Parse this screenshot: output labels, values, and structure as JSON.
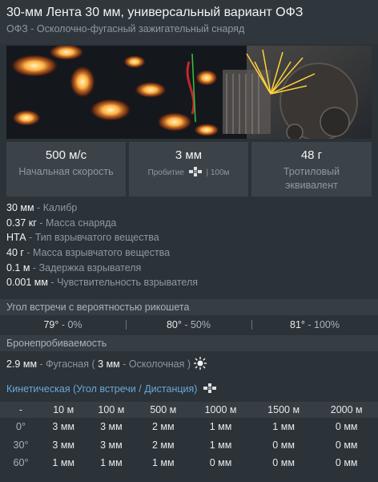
{
  "header": {
    "title": "30-мм Лента 30 мм, универсальный вариант ОФЗ",
    "subtitle": "ОФЗ - Осколочно-фугасный зажигательный снаряд"
  },
  "stats": [
    {
      "value": "500 м/с",
      "label": "Начальная скорость"
    },
    {
      "value": "3 мм",
      "label_prefix": "Пробитие",
      "label_suffix": "| 100м",
      "icon": "penetration-target-icon"
    },
    {
      "value": "48 г",
      "label": "Тротиловый эквивалент"
    }
  ],
  "properties": [
    {
      "value": "30 мм",
      "label": "Калибр"
    },
    {
      "value": "0.37 кг",
      "label": "Масса снаряда"
    },
    {
      "value": "НТА",
      "label": "Тип взрывчатого вещества"
    },
    {
      "value": "40 г",
      "label": "Масса взрывчатого вещества"
    },
    {
      "value": "0.1 м",
      "label": "Задержка взрывателя"
    },
    {
      "value": "0.001 мм",
      "label": "Чувствительность взрывателя"
    }
  ],
  "ricochet": {
    "title": "Угол встречи с вероятностью рикошета",
    "items": [
      {
        "angle": "79°",
        "pct": "0%"
      },
      {
        "angle": "80°",
        "pct": "50%"
      },
      {
        "angle": "81°",
        "pct": "100%"
      }
    ]
  },
  "penetration": {
    "title": "Бронепробиваемость",
    "he_value": "2.9 мм",
    "he_label": "Фугасная",
    "frag_value": "3 мм",
    "frag_label": "Осколочная",
    "icon": "explosion-icon"
  },
  "kinetic": {
    "title": "Кинетическая (Угол встречи / Дистанция)",
    "icon": "penetration-target-icon",
    "corner": "-",
    "distances": [
      "10 м",
      "100 м",
      "500 м",
      "1000 м",
      "1500 м",
      "2000 м"
    ],
    "rows": [
      {
        "angle": "0°",
        "values": [
          "3 мм",
          "3 мм",
          "2 мм",
          "1 мм",
          "1 мм",
          "0 мм"
        ]
      },
      {
        "angle": "30°",
        "values": [
          "3 мм",
          "3 мм",
          "2 мм",
          "1 мм",
          "0 мм",
          "0 мм"
        ]
      },
      {
        "angle": "60°",
        "values": [
          "1 мм",
          "1 мм",
          "1 мм",
          "0 мм",
          "0 мм",
          "0 мм"
        ]
      }
    ]
  },
  "colors": {
    "background": "#2b3238",
    "panel": "#3b4349",
    "accent_blue": "#6aa8d8",
    "muted_text": "#8e989f"
  }
}
